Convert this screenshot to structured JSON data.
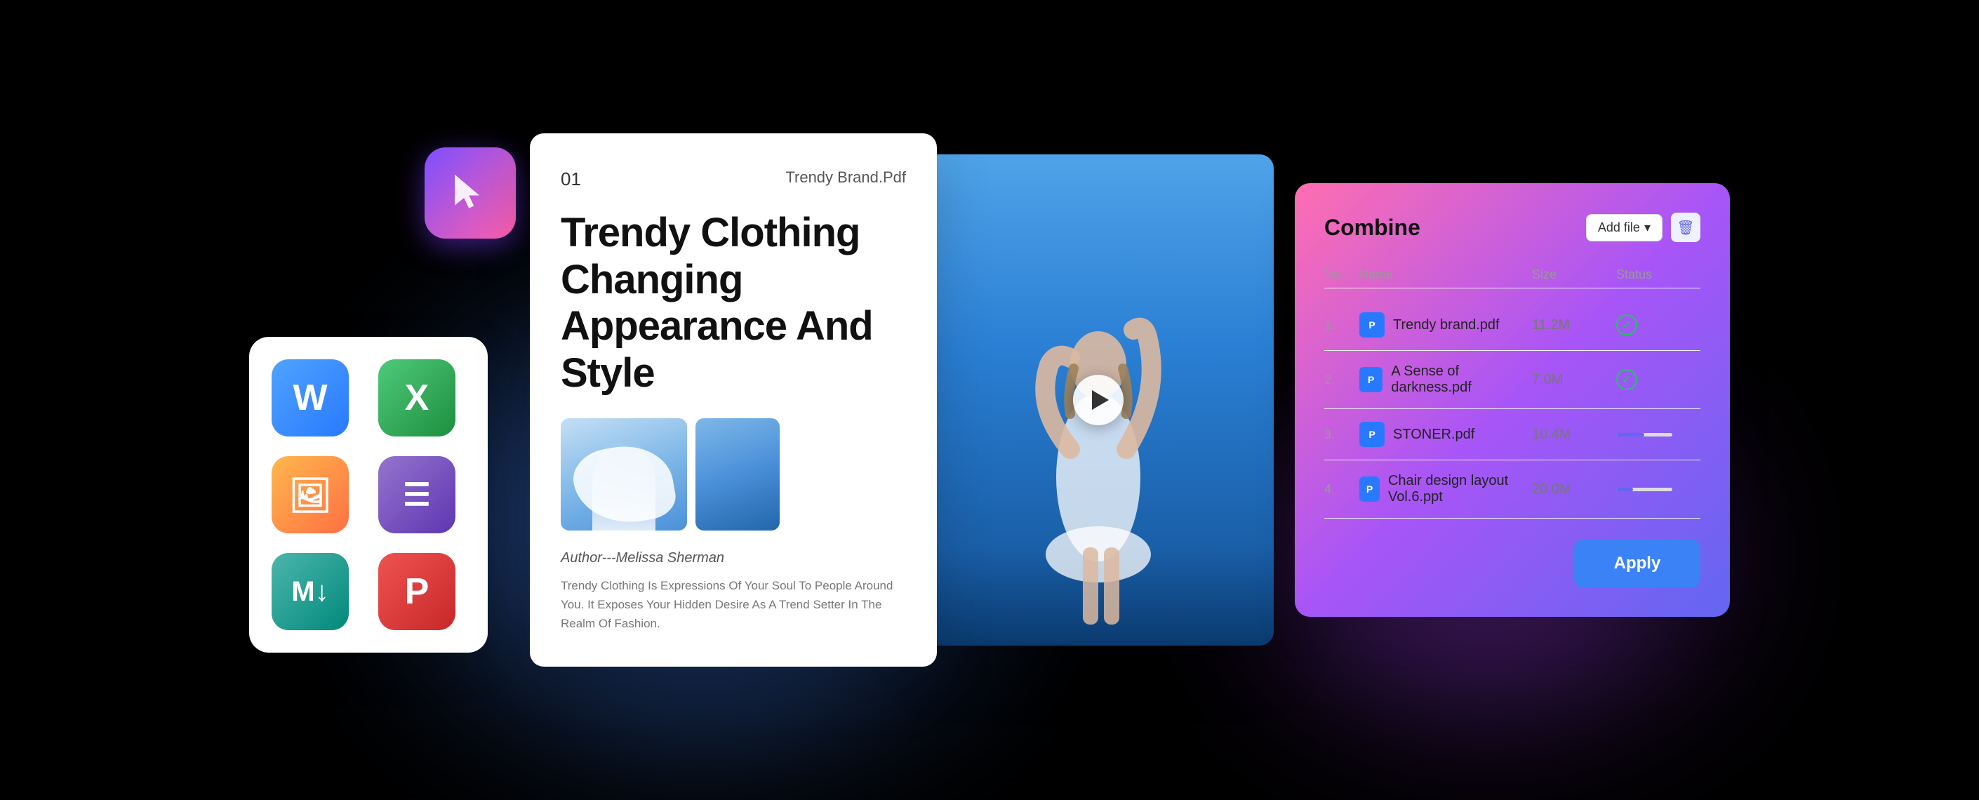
{
  "background": {
    "color": "#000000"
  },
  "app_logo": {
    "icon": "cursor-arrow"
  },
  "app_icons": [
    {
      "label": "W",
      "type": "word",
      "name": "Word"
    },
    {
      "label": "X",
      "type": "excel",
      "name": "Excel"
    },
    {
      "label": "🖼",
      "type": "photo",
      "name": "Photos"
    },
    {
      "label": "≡",
      "type": "present",
      "name": "Presentation"
    },
    {
      "label": "M↓",
      "type": "md",
      "name": "Markdown"
    },
    {
      "label": "P",
      "type": "pdf",
      "name": "PDF"
    }
  ],
  "document": {
    "number": "01",
    "filename": "Trendy Brand.Pdf",
    "title": "Trendy Clothing Changing Appearance And Style",
    "author": "Author---Melissa Sherman",
    "body": "Trendy Clothing Is Expressions Of Your Soul To People Around You. It Exposes Your Hidden Desire As A Trend Setter In The Realm Of Fashion.",
    "images": [
      "fashion-photo-1",
      "fashion-photo-2"
    ]
  },
  "combine": {
    "title": "Combine",
    "add_file_label": "Add file",
    "table_headers": [
      "No.",
      "Name",
      "Size",
      "Status"
    ],
    "files": [
      {
        "no": "1.",
        "name": "Trendy brand.pdf",
        "size": "11.2M",
        "status": "done"
      },
      {
        "no": "2.",
        "name": "A Sense of darkness.pdf",
        "size": "7.0M",
        "status": "done"
      },
      {
        "no": "3.",
        "name": "STONER.pdf",
        "size": "10.4M",
        "status": "progress",
        "progress": 50
      },
      {
        "no": "4.",
        "name": "Chair design layout Vol.6.ppt",
        "size": "20.0M",
        "status": "progress",
        "progress": 30
      }
    ],
    "apply_label": "Apply"
  }
}
